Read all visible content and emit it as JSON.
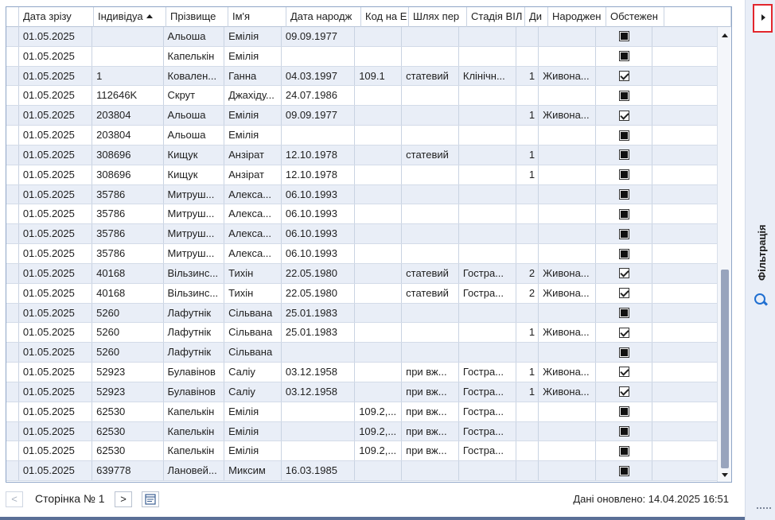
{
  "columns": [
    "",
    "Дата зрізу",
    "Індивідуа",
    "Прізвище",
    "Ім'я",
    "Дата народж",
    "Код на Е",
    "Шлях пер",
    "Стадія ВІЛ",
    "Ди",
    "Народжен",
    "Обстежен",
    ""
  ],
  "sorted_column_index": 2,
  "rows": [
    [
      "01.05.2025",
      "",
      "Альоша",
      "Емілія",
      "09.09.1977",
      "",
      "",
      "",
      "",
      "",
      "ind"
    ],
    [
      "01.05.2025",
      "",
      "Капелькін",
      "Емілія",
      "",
      "",
      "",
      "",
      "",
      "",
      "ind"
    ],
    [
      "01.05.2025",
      "1",
      "Ковален...",
      "Ганна",
      "04.03.1997",
      "109.1",
      "статевий",
      "Клінічн...",
      "1",
      "Живона...",
      "on"
    ],
    [
      "01.05.2025",
      "112646K",
      "Скрут",
      "Джахіду...",
      "24.07.1986",
      "",
      "",
      "",
      "",
      "",
      "ind"
    ],
    [
      "01.05.2025",
      "203804",
      "Альоша",
      "Емілія",
      "09.09.1977",
      "",
      "",
      "",
      "1",
      "Живона...",
      "on"
    ],
    [
      "01.05.2025",
      "203804",
      "Альоша",
      "Емілія",
      "",
      "",
      "",
      "",
      "",
      "",
      "ind"
    ],
    [
      "01.05.2025",
      "308696",
      "Кищук",
      "Анзірат",
      "12.10.1978",
      "",
      "статевий",
      "",
      "1",
      "",
      "ind"
    ],
    [
      "01.05.2025",
      "308696",
      "Кищук",
      "Анзірат",
      "12.10.1978",
      "",
      "",
      "",
      "1",
      "",
      "ind"
    ],
    [
      "01.05.2025",
      "35786",
      "Митруш...",
      "Алекса...",
      "06.10.1993",
      "",
      "",
      "",
      "",
      "",
      "ind"
    ],
    [
      "01.05.2025",
      "35786",
      "Митруш...",
      "Алекса...",
      "06.10.1993",
      "",
      "",
      "",
      "",
      "",
      "ind"
    ],
    [
      "01.05.2025",
      "35786",
      "Митруш...",
      "Алекса...",
      "06.10.1993",
      "",
      "",
      "",
      "",
      "",
      "ind"
    ],
    [
      "01.05.2025",
      "35786",
      "Митруш...",
      "Алекса...",
      "06.10.1993",
      "",
      "",
      "",
      "",
      "",
      "ind"
    ],
    [
      "01.05.2025",
      "40168",
      "Вільзинс...",
      "Тихін",
      "22.05.1980",
      "",
      "статевий",
      "Гостра...",
      "2",
      "Живона...",
      "on"
    ],
    [
      "01.05.2025",
      "40168",
      "Вільзинс...",
      "Тихін",
      "22.05.1980",
      "",
      "статевий",
      "Гостра...",
      "2",
      "Живона...",
      "on"
    ],
    [
      "01.05.2025",
      "5260",
      "Лафутнік",
      "Сільвана",
      "25.01.1983",
      "",
      "",
      "",
      "",
      "",
      "ind"
    ],
    [
      "01.05.2025",
      "5260",
      "Лафутнік",
      "Сільвана",
      "25.01.1983",
      "",
      "",
      "",
      "1",
      "Живона...",
      "on"
    ],
    [
      "01.05.2025",
      "5260",
      "Лафутнік",
      "Сільвана",
      "",
      "",
      "",
      "",
      "",
      "",
      "ind"
    ],
    [
      "01.05.2025",
      "52923",
      "Булавінов",
      "Саліу",
      "03.12.1958",
      "",
      "при вж...",
      "Гостра...",
      "1",
      "Живона...",
      "on"
    ],
    [
      "01.05.2025",
      "52923",
      "Булавінов",
      "Саліу",
      "03.12.1958",
      "",
      "при вж...",
      "Гостра...",
      "1",
      "Живона...",
      "on"
    ],
    [
      "01.05.2025",
      "62530",
      "Капелькін",
      "Емілія",
      "",
      "109.2,...",
      "при вж...",
      "Гостра...",
      "",
      "",
      "ind"
    ],
    [
      "01.05.2025",
      "62530",
      "Капелькін",
      "Емілія",
      "",
      "109.2,...",
      "при вж...",
      "Гостра...",
      "",
      "",
      "ind"
    ],
    [
      "01.05.2025",
      "62530",
      "Капелькін",
      "Емілія",
      "",
      "109.2,...",
      "при вж...",
      "Гостра...",
      "",
      "",
      "ind"
    ],
    [
      "01.05.2025",
      "639778",
      "Лановей...",
      "Миксим",
      "16.03.1985",
      "",
      "",
      "",
      "",
      "",
      "ind"
    ]
  ],
  "pager": {
    "prev_label": "<",
    "page_label": "Сторінка № 1",
    "next_label": ">",
    "status": "Дані оновлено: 14.04.2025 16:51"
  },
  "side_panel": {
    "label": "Фільтрація",
    "icon": "search-icon"
  },
  "colors": {
    "row_alt": "#e9eef7",
    "highlight_border": "#e2262d",
    "filter_icon": "#1f6fd1"
  }
}
